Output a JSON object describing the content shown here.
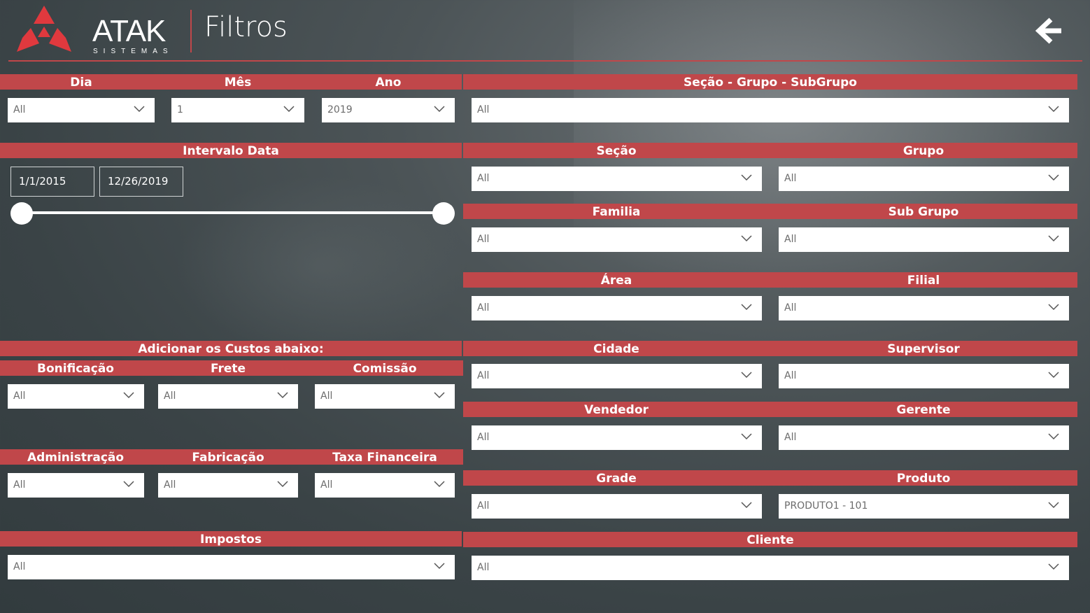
{
  "header": {
    "logo_name": "ATAK",
    "logo_sub": "SISTEMAS",
    "title": "Filtros",
    "back_icon": "arrow-left-icon"
  },
  "colors": {
    "accent": "#c0474a",
    "field_bg": "#ffffff",
    "text_light": "#ffffff",
    "field_text": "#6b6b6b"
  },
  "filters": {
    "dia": {
      "label": "Dia",
      "value": "All"
    },
    "mes": {
      "label": "Mês",
      "value": "1"
    },
    "ano": {
      "label": "Ano",
      "value": "2019"
    },
    "intervalo": {
      "label": "Intervalo Data",
      "start": "1/1/2015",
      "end": "12/26/2019"
    },
    "custos_label": "Adicionar os Custos abaixo:",
    "bonificacao": {
      "label": "Bonificação",
      "value": "All"
    },
    "frete": {
      "label": "Frete",
      "value": "All"
    },
    "comissao": {
      "label": "Comissão",
      "value": "All"
    },
    "administracao": {
      "label": "Administração",
      "value": "All"
    },
    "fabricacao": {
      "label": "Fabricação",
      "value": "All"
    },
    "taxa": {
      "label": "Taxa Financeira",
      "value": "All"
    },
    "impostos": {
      "label": "Impostos",
      "value": "All"
    },
    "secao_grupo_sub": {
      "label": "Seção - Grupo - SubGrupo",
      "value": "All"
    },
    "secao": {
      "label": "Seção",
      "value": "All"
    },
    "grupo": {
      "label": "Grupo",
      "value": "All"
    },
    "familia": {
      "label": "Familia",
      "value": "All"
    },
    "subgrupo": {
      "label": "Sub Grupo",
      "value": "All"
    },
    "area": {
      "label": "Área",
      "value": "All"
    },
    "filial": {
      "label": "Filial",
      "value": "All"
    },
    "cidade": {
      "label": "Cidade",
      "value": "All"
    },
    "supervisor": {
      "label": "Supervisor",
      "value": "All"
    },
    "vendedor": {
      "label": "Vendedor",
      "value": "All"
    },
    "gerente": {
      "label": "Gerente",
      "value": "All"
    },
    "grade": {
      "label": "Grade",
      "value": "All"
    },
    "produto": {
      "label": "Produto",
      "value": "PRODUTO1 - 101"
    },
    "cliente": {
      "label": "Cliente",
      "value": "All"
    }
  }
}
